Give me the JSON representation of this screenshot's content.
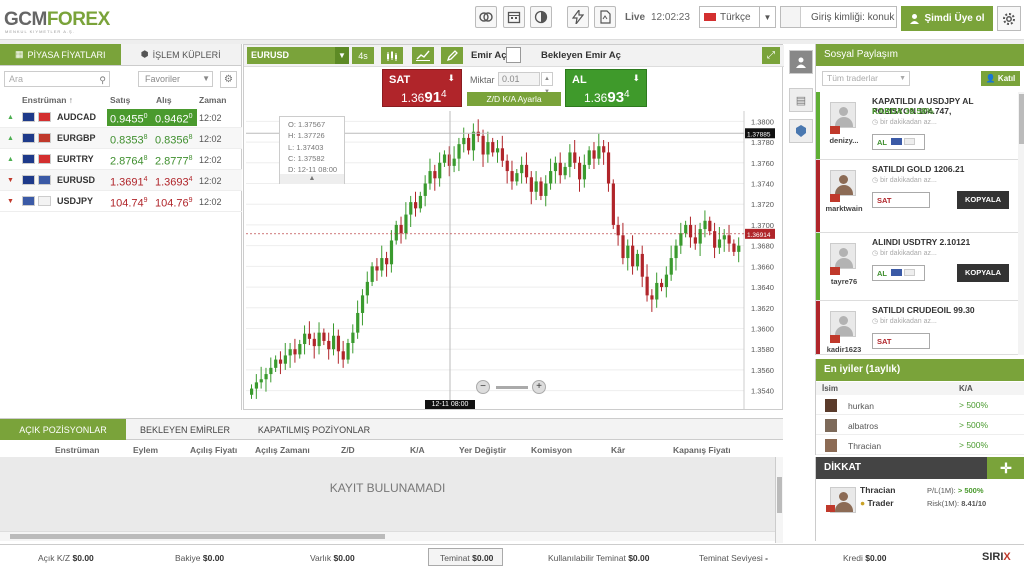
{
  "header": {
    "logo_a": "GCM",
    "logo_b": "FOREX",
    "logo_sub": "MENKUL KIYMETLER A.Ş.",
    "live": "Live",
    "time": "12:02:23",
    "language": "Türkçe",
    "login_placeholder": "Giriş kimliği: konuk",
    "signup": "Şimdi Üye ol"
  },
  "left": {
    "tab_prices": "PİYASA FİYATLARI",
    "tab_baskets": "İŞLEM KÜPLERİ",
    "search_placeholder": "Ara",
    "favorites": "Favoriler",
    "col_instrument": "Enstrüman ↑",
    "col_bid": "Satış",
    "col_ask": "Alış",
    "col_time": "Zaman",
    "quotes": [
      {
        "sym": "AUDCAD",
        "bid": "0.9455",
        "bid_sup": "0",
        "ask": "0.9462",
        "ask_sup": "0",
        "time": "12:02",
        "dir": "up"
      },
      {
        "sym": "EURGBP",
        "bid": "0.8353",
        "bid_sup": "8",
        "ask": "0.8356",
        "ask_sup": "8",
        "time": "12:02",
        "dir": "up"
      },
      {
        "sym": "EURTRY",
        "bid": "2.8764",
        "bid_sup": "8",
        "ask": "2.8777",
        "ask_sup": "8",
        "time": "12:02",
        "dir": "up"
      },
      {
        "sym": "EURUSD",
        "bid": "1.3691",
        "bid_sup": "4",
        "ask": "1.3693",
        "ask_sup": "4",
        "time": "12:02",
        "dir": "down"
      },
      {
        "sym": "USDJPY",
        "bid": "104.74",
        "bid_sup": "9",
        "ask": "104.76",
        "ask_sup": "9",
        "time": "12:02",
        "dir": "down"
      }
    ]
  },
  "chart": {
    "symbol": "EURUSD",
    "timeframe": "4s",
    "order_label": "Emir Aç",
    "pending_label": "Bekleyen Emir Aç",
    "sell_label": "SAT",
    "sell_price_a": "1.36",
    "sell_price_b": "91",
    "sell_price_c": "4",
    "buy_label": "AL",
    "buy_price_a": "1.36",
    "buy_price_b": "93",
    "buy_price_c": "4",
    "amount_label": "Miktar",
    "amount_value": "0.01",
    "sltp_label": "Z/D K/A Ayarla",
    "ohlc": {
      "o": "O:   1.37567",
      "h": "H:   1.37726",
      "l": "L:   1.37403",
      "c": "C:   1.37582",
      "d": "D:   12-11 08:00"
    },
    "cursor_x_label": "12-11 08:00",
    "crosshair_price": "1.37885",
    "last_price": "1.36914",
    "y_ticks": [
      "1.3800",
      "1.3780",
      "1.3760",
      "1.3740",
      "1.3720",
      "1.3700",
      "1.3680",
      "1.3660",
      "1.3640",
      "1.3620",
      "1.3600",
      "1.3580",
      "1.3560",
      "1.3540"
    ]
  },
  "chart_data": {
    "type": "candlestick",
    "ylim": [
      1.353,
      1.381
    ],
    "closes": [
      1.3542,
      1.3548,
      1.3551,
      1.3556,
      1.3562,
      1.357,
      1.3566,
      1.3574,
      1.358,
      1.3575,
      1.3585,
      1.3595,
      1.359,
      1.3583,
      1.3596,
      1.3588,
      1.358,
      1.3593,
      1.3578,
      1.357,
      1.3586,
      1.3596,
      1.3615,
      1.3632,
      1.3645,
      1.366,
      1.3656,
      1.3668,
      1.3662,
      1.3685,
      1.37,
      1.3692,
      1.371,
      1.3722,
      1.3716,
      1.3728,
      1.374,
      1.3752,
      1.3745,
      1.376,
      1.3768,
      1.3757,
      1.3764,
      1.3778,
      1.3784,
      1.3772,
      1.379,
      1.3786,
      1.3768,
      1.378,
      1.377,
      1.3774,
      1.3762,
      1.3752,
      1.3742,
      1.375,
      1.3758,
      1.3746,
      1.3732,
      1.3742,
      1.3728,
      1.374,
      1.3752,
      1.376,
      1.3748,
      1.3756,
      1.377,
      1.376,
      1.3744,
      1.3758,
      1.3772,
      1.3764,
      1.3776,
      1.377,
      1.374,
      1.37,
      1.369,
      1.3668,
      1.368,
      1.366,
      1.3672,
      1.365,
      1.3632,
      1.3628,
      1.3644,
      1.364,
      1.3652,
      1.3668,
      1.368,
      1.3692,
      1.37,
      1.3688,
      1.3682,
      1.3696,
      1.3704,
      1.3694,
      1.3678,
      1.3686,
      1.369,
      1.3682,
      1.3674,
      1.368
    ]
  },
  "positions": {
    "tab_open": "AÇIK POZİSYONLAR",
    "tab_pending": "BEKLEYEN EMİRLER",
    "tab_closed": "KAPATILMIŞ POZİYONLAR",
    "cols": [
      "Enstrüman",
      "Eylem",
      "Açılış Fiyatı",
      "Açılış Zamanı",
      "Z/D",
      "K/A",
      "Yer Değiştir",
      "Komisyon",
      "Kâr",
      "Kapanış Fiyatı"
    ],
    "empty": "KAYIT BULUNAMADI"
  },
  "footer": {
    "items": [
      {
        "label": "Açık K/Z",
        "value": "$0.00"
      },
      {
        "label": "Bakiye",
        "value": "$0.00"
      },
      {
        "label": "Varlık",
        "value": "$0.00"
      },
      {
        "label": "Teminat",
        "value": "$0.00"
      },
      {
        "label": "Kullanılabilir Teminat",
        "value": "$0.00"
      },
      {
        "label": "Teminat Seviyesi",
        "value": "-"
      },
      {
        "label": "Kredi",
        "value": "$0.00"
      }
    ],
    "brand_a": "SIRI",
    "brand_b": "X"
  },
  "social": {
    "title": "Sosyal Paylaşım",
    "filter": "Tüm traderlar",
    "join": "Katıl",
    "posts": [
      {
        "user": "denizy...",
        "title": "KAPATILDI A USDJPY AL POZISYON 104.747,",
        "profit": "KARDA 39.58%",
        "time": "bir dakikadan az...",
        "btn": "AL",
        "type": "g"
      },
      {
        "user": "marktwain",
        "title": "SATILDI GOLD 1206.21",
        "time": "bir dakikadan az...",
        "btn": "SAT",
        "copy": "KOPYALA",
        "type": "r"
      },
      {
        "user": "tayre76",
        "title": "ALINDI USDTRY 2.10121",
        "time": "bir dakikadan az...",
        "btn": "AL",
        "copy": "KOPYALA",
        "type": "g"
      },
      {
        "user": "kadir1623",
        "title": "SATILDI CRUDEOIL 99.30",
        "time": "bir dakikadan az...",
        "btn": "SAT",
        "type": "r"
      }
    ]
  },
  "best": {
    "title": "En iyiler (1aylık)",
    "col_name": "İsim",
    "col_ka": "K/A",
    "rows": [
      {
        "name": "hurkan",
        "pct": "> 500%"
      },
      {
        "name": "albatros",
        "pct": "> 500%"
      },
      {
        "name": "Thracian",
        "pct": "> 500%"
      }
    ]
  },
  "dikkat": {
    "title": "DİKKAT",
    "name": "Thracian",
    "role": "Trader",
    "pl_label": "P/L(1M):",
    "pl_value": "> 500%",
    "risk_label": "Risk(1M):",
    "risk_value": "8.41/10"
  }
}
